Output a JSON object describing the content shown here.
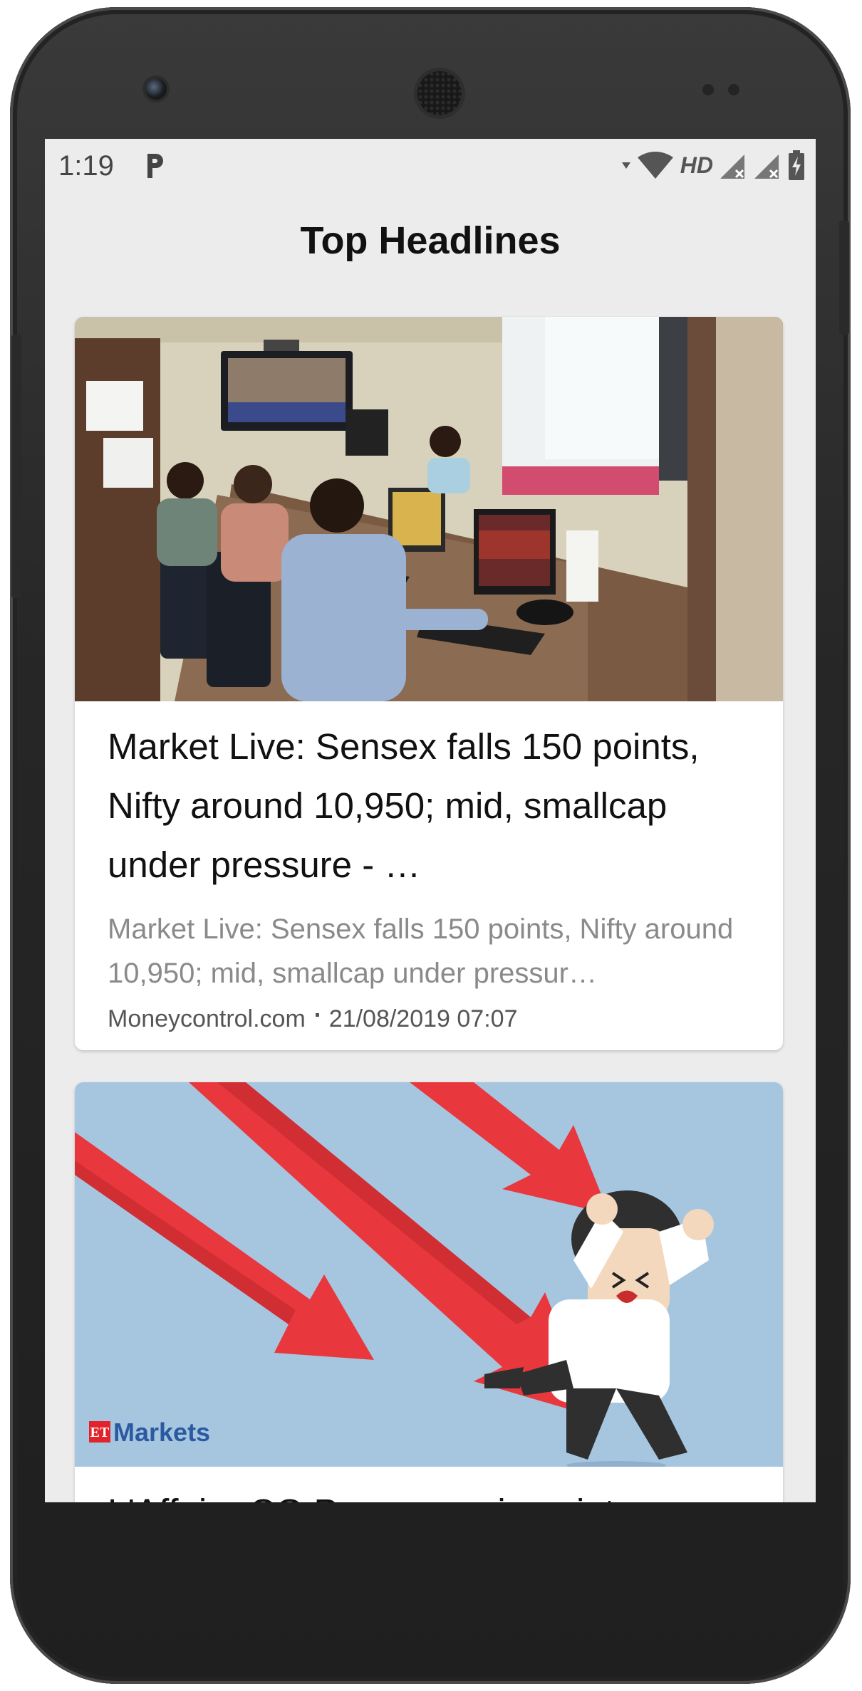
{
  "status_bar": {
    "time": "1:19",
    "network_label": "HD",
    "icons": [
      "parking-notification-icon",
      "wifi-icon",
      "signal-icon",
      "signal-icon",
      "battery-charging-icon"
    ]
  },
  "app": {
    "title": "Top Headlines"
  },
  "articles": [
    {
      "title": "Market Live: Sensex falls 150 points, Nifty around 10,950; mid, smallcap under pressure - …",
      "description": "Market Live: Sensex falls 150 points, Nifty around 10,950; mid, smallcap under pressur…",
      "source": "Moneycontrol.com",
      "published": "21/08/2019 07:07"
    },
    {
      "title": "L'Affaire CG Power a pain point",
      "image_logo": {
        "prefix": "ET",
        "name": "Markets"
      }
    }
  ],
  "colors": {
    "screen_background": "#ececec",
    "card_background": "#ffffff",
    "title_text": "#111111",
    "description_text": "#8a8a8a",
    "meta_text": "#555555",
    "arrow_red": "#e8383d",
    "illustration_sky": "#a6c6e0"
  }
}
